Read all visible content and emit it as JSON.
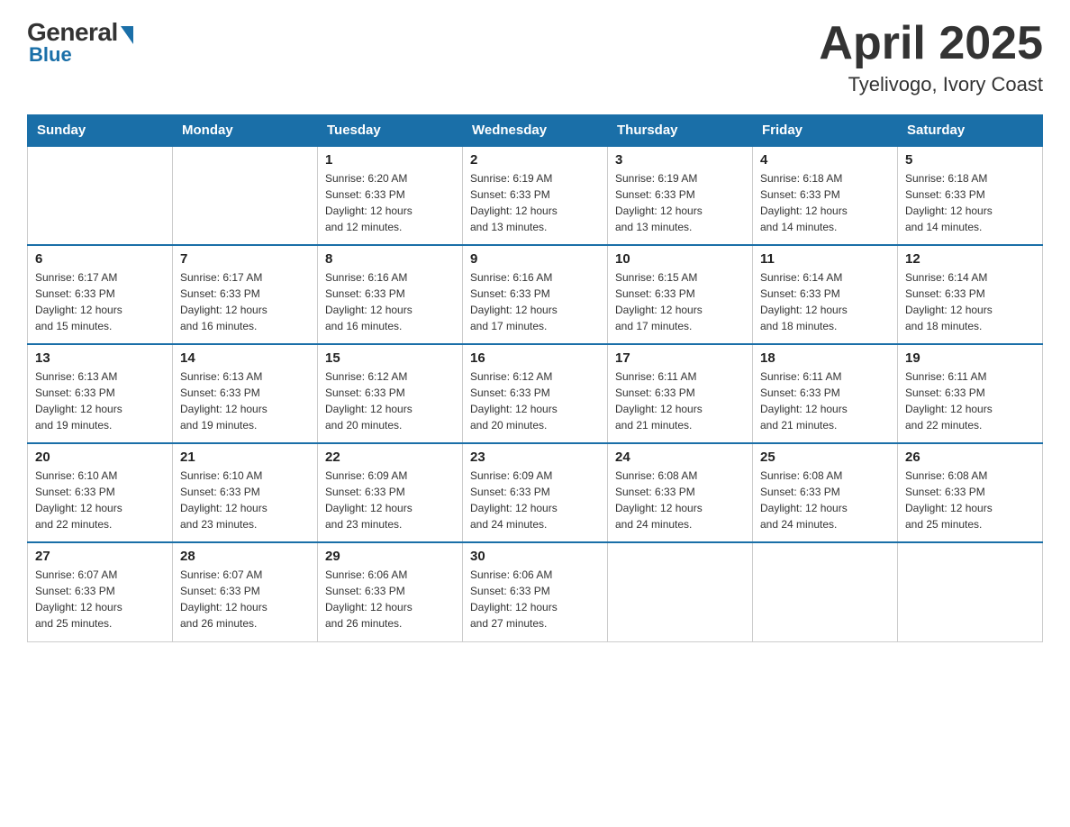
{
  "header": {
    "title": "April 2025",
    "subtitle": "Tyelivogo, Ivory Coast",
    "logo_general": "General",
    "logo_blue": "Blue"
  },
  "days_of_week": [
    "Sunday",
    "Monday",
    "Tuesday",
    "Wednesday",
    "Thursday",
    "Friday",
    "Saturday"
  ],
  "weeks": [
    [
      {
        "day": "",
        "info": ""
      },
      {
        "day": "",
        "info": ""
      },
      {
        "day": "1",
        "info": "Sunrise: 6:20 AM\nSunset: 6:33 PM\nDaylight: 12 hours\nand 12 minutes."
      },
      {
        "day": "2",
        "info": "Sunrise: 6:19 AM\nSunset: 6:33 PM\nDaylight: 12 hours\nand 13 minutes."
      },
      {
        "day": "3",
        "info": "Sunrise: 6:19 AM\nSunset: 6:33 PM\nDaylight: 12 hours\nand 13 minutes."
      },
      {
        "day": "4",
        "info": "Sunrise: 6:18 AM\nSunset: 6:33 PM\nDaylight: 12 hours\nand 14 minutes."
      },
      {
        "day": "5",
        "info": "Sunrise: 6:18 AM\nSunset: 6:33 PM\nDaylight: 12 hours\nand 14 minutes."
      }
    ],
    [
      {
        "day": "6",
        "info": "Sunrise: 6:17 AM\nSunset: 6:33 PM\nDaylight: 12 hours\nand 15 minutes."
      },
      {
        "day": "7",
        "info": "Sunrise: 6:17 AM\nSunset: 6:33 PM\nDaylight: 12 hours\nand 16 minutes."
      },
      {
        "day": "8",
        "info": "Sunrise: 6:16 AM\nSunset: 6:33 PM\nDaylight: 12 hours\nand 16 minutes."
      },
      {
        "day": "9",
        "info": "Sunrise: 6:16 AM\nSunset: 6:33 PM\nDaylight: 12 hours\nand 17 minutes."
      },
      {
        "day": "10",
        "info": "Sunrise: 6:15 AM\nSunset: 6:33 PM\nDaylight: 12 hours\nand 17 minutes."
      },
      {
        "day": "11",
        "info": "Sunrise: 6:14 AM\nSunset: 6:33 PM\nDaylight: 12 hours\nand 18 minutes."
      },
      {
        "day": "12",
        "info": "Sunrise: 6:14 AM\nSunset: 6:33 PM\nDaylight: 12 hours\nand 18 minutes."
      }
    ],
    [
      {
        "day": "13",
        "info": "Sunrise: 6:13 AM\nSunset: 6:33 PM\nDaylight: 12 hours\nand 19 minutes."
      },
      {
        "day": "14",
        "info": "Sunrise: 6:13 AM\nSunset: 6:33 PM\nDaylight: 12 hours\nand 19 minutes."
      },
      {
        "day": "15",
        "info": "Sunrise: 6:12 AM\nSunset: 6:33 PM\nDaylight: 12 hours\nand 20 minutes."
      },
      {
        "day": "16",
        "info": "Sunrise: 6:12 AM\nSunset: 6:33 PM\nDaylight: 12 hours\nand 20 minutes."
      },
      {
        "day": "17",
        "info": "Sunrise: 6:11 AM\nSunset: 6:33 PM\nDaylight: 12 hours\nand 21 minutes."
      },
      {
        "day": "18",
        "info": "Sunrise: 6:11 AM\nSunset: 6:33 PM\nDaylight: 12 hours\nand 21 minutes."
      },
      {
        "day": "19",
        "info": "Sunrise: 6:11 AM\nSunset: 6:33 PM\nDaylight: 12 hours\nand 22 minutes."
      }
    ],
    [
      {
        "day": "20",
        "info": "Sunrise: 6:10 AM\nSunset: 6:33 PM\nDaylight: 12 hours\nand 22 minutes."
      },
      {
        "day": "21",
        "info": "Sunrise: 6:10 AM\nSunset: 6:33 PM\nDaylight: 12 hours\nand 23 minutes."
      },
      {
        "day": "22",
        "info": "Sunrise: 6:09 AM\nSunset: 6:33 PM\nDaylight: 12 hours\nand 23 minutes."
      },
      {
        "day": "23",
        "info": "Sunrise: 6:09 AM\nSunset: 6:33 PM\nDaylight: 12 hours\nand 24 minutes."
      },
      {
        "day": "24",
        "info": "Sunrise: 6:08 AM\nSunset: 6:33 PM\nDaylight: 12 hours\nand 24 minutes."
      },
      {
        "day": "25",
        "info": "Sunrise: 6:08 AM\nSunset: 6:33 PM\nDaylight: 12 hours\nand 24 minutes."
      },
      {
        "day": "26",
        "info": "Sunrise: 6:08 AM\nSunset: 6:33 PM\nDaylight: 12 hours\nand 25 minutes."
      }
    ],
    [
      {
        "day": "27",
        "info": "Sunrise: 6:07 AM\nSunset: 6:33 PM\nDaylight: 12 hours\nand 25 minutes."
      },
      {
        "day": "28",
        "info": "Sunrise: 6:07 AM\nSunset: 6:33 PM\nDaylight: 12 hours\nand 26 minutes."
      },
      {
        "day": "29",
        "info": "Sunrise: 6:06 AM\nSunset: 6:33 PM\nDaylight: 12 hours\nand 26 minutes."
      },
      {
        "day": "30",
        "info": "Sunrise: 6:06 AM\nSunset: 6:33 PM\nDaylight: 12 hours\nand 27 minutes."
      },
      {
        "day": "",
        "info": ""
      },
      {
        "day": "",
        "info": ""
      },
      {
        "day": "",
        "info": ""
      }
    ]
  ]
}
